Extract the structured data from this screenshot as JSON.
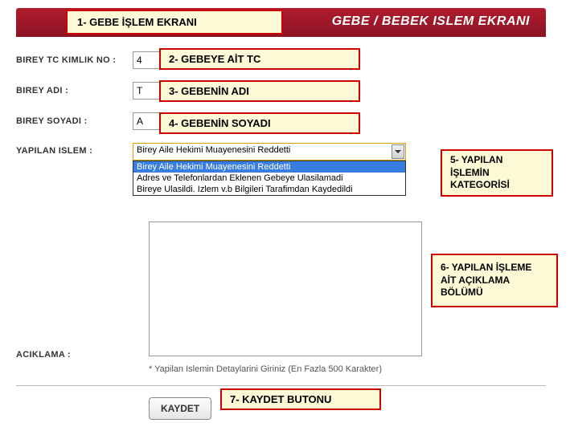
{
  "header": {
    "title": "GEBE / BEBEK ISLEM EKRANI"
  },
  "labels": {
    "tc": "BIREY TC KIMLIK NO :",
    "name": "BIREY ADI :",
    "surname": "BIREY SOYADI :",
    "operation": "YAPILAN ISLEM :",
    "description": "ACIKLAMA :"
  },
  "values": {
    "tc_value": "4",
    "name_value": "T",
    "surname_value": "A"
  },
  "select": {
    "selected": "Birey Aile Hekimi Muayenesini Reddetti",
    "options": [
      "Birey Aile Hekimi Muayenesini Reddetti",
      "Adres ve Telefonlardan Eklenen Gebeye Ulasilamadi",
      "Bireye Ulasildi. Izlem v.b Bilgileri Tarafimdan Kaydedildi"
    ]
  },
  "hint": "* Yapilan Islemin Detaylarini Giriniz (En Fazla 500 Karakter)",
  "buttons": {
    "save": "KAYDET"
  },
  "annotations": {
    "a1": "1- GEBE İŞLEM EKRANI",
    "a2": "2- GEBEYE AİT TC",
    "a3": "3- GEBENİN ADI",
    "a4": "4- GEBENİN SOYADI",
    "a5": "5- YAPILAN İŞLEMİN KATEGORİSİ",
    "a6": "6- YAPILAN İŞLEME AİT AÇIKLAMA BÖLÜMÜ",
    "a7": "7- KAYDET BUTONU"
  }
}
